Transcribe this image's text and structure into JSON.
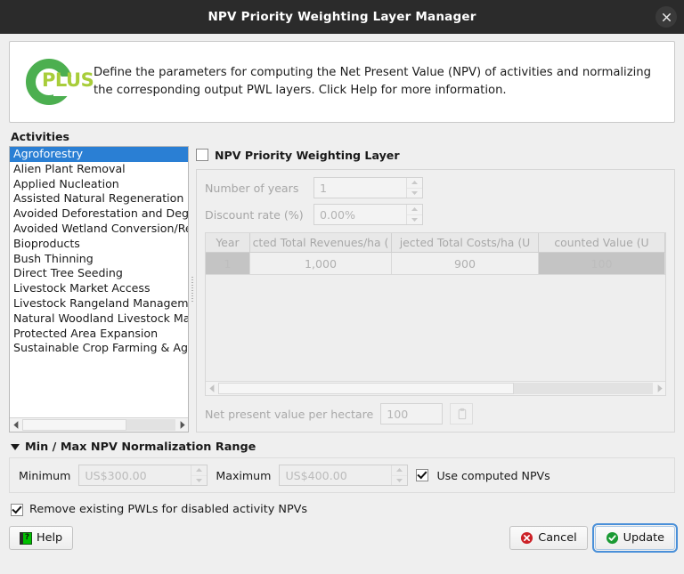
{
  "window": {
    "title": "NPV Priority Weighting Layer Manager",
    "close_icon": "close-icon"
  },
  "banner": {
    "logo_text": "PLUS",
    "description": "Define the parameters for computing the Net Present Value (NPV) of activities and normalizing the corresponding output PWL layers. Click Help for more information."
  },
  "activities": {
    "label": "Activities",
    "items": [
      "Agroforestry",
      "Alien Plant Removal",
      "Applied Nucleation",
      "Assisted Natural Regeneration",
      "Avoided Deforestation and Degradation",
      "Avoided Wetland Conversion/Restoration",
      "Bioproducts",
      "Bush Thinning",
      "Direct Tree Seeding",
      "Livestock Market Access",
      "Livestock Rangeland Management",
      "Natural Woodland Livestock Management",
      "Protected Area Expansion",
      "Sustainable Crop Farming & Agroforestry"
    ],
    "selected": "Agroforestry"
  },
  "npv_panel": {
    "enable_checkbox_label": "NPV Priority Weighting Layer",
    "enable_checked": false,
    "years": {
      "label": "Number of years",
      "value": "1"
    },
    "discount_rate": {
      "label": "Discount rate (%)",
      "value": "0.00%"
    },
    "table": {
      "headers": [
        "Year",
        "cted Total Revenues/ha (",
        "jected Total Costs/ha (U",
        "counted Value (U"
      ],
      "rows": [
        {
          "year": "1",
          "revenues": "1,000",
          "costs": "900",
          "discounted": "100"
        }
      ]
    },
    "npv_per_hectare": {
      "label": "Net present value per hectare",
      "value": "100",
      "copy_icon": "copy-icon"
    }
  },
  "normalization": {
    "title": "Min / Max NPV Normalization Range",
    "expanded": true,
    "minimum": {
      "label": "Minimum",
      "value": "US$300.00"
    },
    "maximum": {
      "label": "Maximum",
      "value": "US$400.00"
    },
    "use_computed": {
      "label": "Use computed NPVs",
      "checked": true
    }
  },
  "remove_pwls": {
    "label": "Remove existing PWLs for disabled activity NPVs",
    "checked": true
  },
  "buttons": {
    "help": "Help",
    "cancel": "Cancel",
    "update": "Update"
  },
  "colors": {
    "titlebar": "#2b2b2b",
    "selection": "#2a7fd4",
    "brand_green": "#4caf50",
    "brand_lime": "#a8cd3a",
    "cancel_red": "#cc2127",
    "update_green": "#1a9a34"
  }
}
